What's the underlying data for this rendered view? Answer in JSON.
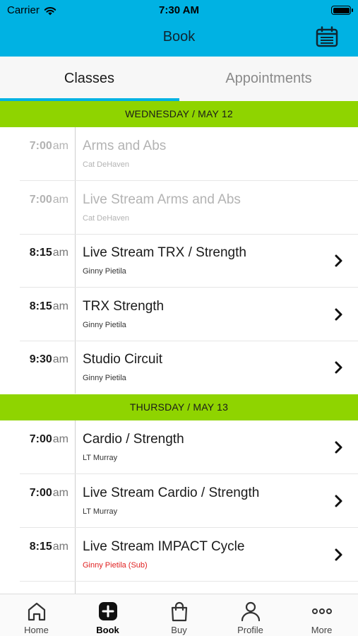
{
  "status_bar": {
    "carrier": "Carrier",
    "time": "7:30 AM"
  },
  "nav": {
    "title": "Book",
    "calendar_icon": "calendar-icon"
  },
  "colors": {
    "brand": "#00b2e3",
    "day_header": "#8fd400",
    "sub_text": "#e02020"
  },
  "tabs": {
    "classes": "Classes",
    "appointments": "Appointments",
    "active": "Classes"
  },
  "days": [
    {
      "label": "WEDNESDAY / MAY 12",
      "classes": [
        {
          "time": "7:00",
          "ampm": "am",
          "title": "Arms and Abs",
          "instructor": "Cat DeHaven"
        },
        {
          "time": "7:00",
          "ampm": "am",
          "title": "Live Stream Arms and Abs",
          "instructor": "Cat DeHaven"
        },
        {
          "time": "8:15",
          "ampm": "am",
          "title": "Live Stream TRX / Strength",
          "instructor": "Ginny Pietila"
        },
        {
          "time": "8:15",
          "ampm": "am",
          "title": "TRX Strength",
          "instructor": "Ginny Pietila"
        },
        {
          "time": "9:30",
          "ampm": "am",
          "title": "Studio Circuit",
          "instructor": "Ginny Pietila"
        }
      ]
    },
    {
      "label": "THURSDAY / MAY 13",
      "classes": [
        {
          "time": "7:00",
          "ampm": "am",
          "title": "Cardio / Strength",
          "instructor": "LT Murray"
        },
        {
          "time": "7:00",
          "ampm": "am",
          "title": "Live Stream Cardio / Strength",
          "instructor": "LT Murray"
        },
        {
          "time": "8:15",
          "ampm": "am",
          "title": "Live Stream IMPACT Cycle",
          "instructor": "Ginny Pietila (Sub)"
        }
      ]
    }
  ],
  "tab_bar": [
    {
      "label": "Home",
      "icon": "home-icon"
    },
    {
      "label": "Book",
      "icon": "plus-square-icon"
    },
    {
      "label": "Buy",
      "icon": "shopping-bag-icon"
    },
    {
      "label": "Profile",
      "icon": "person-icon"
    },
    {
      "label": "More",
      "icon": "more-dots-icon"
    }
  ]
}
